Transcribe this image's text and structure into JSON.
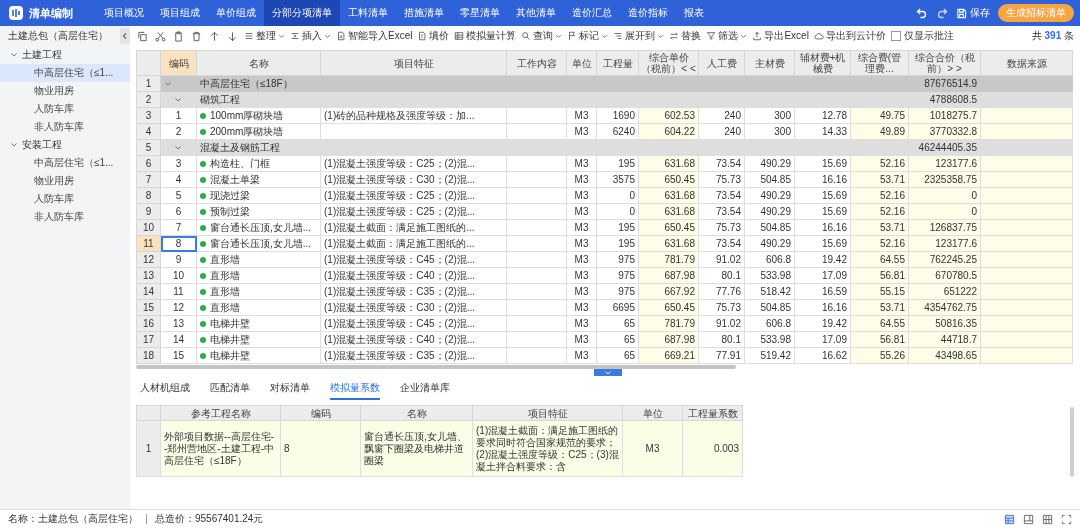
{
  "app": {
    "title": "清单编制"
  },
  "nav": [
    {
      "label": "项目概况",
      "selected": false
    },
    {
      "label": "项目组成",
      "selected": false
    },
    {
      "label": "单价组成",
      "selected": false
    },
    {
      "label": "分部分项清单",
      "selected": true
    },
    {
      "label": "工料清单",
      "selected": false
    },
    {
      "label": "措施清单",
      "selected": false
    },
    {
      "label": "零星清单",
      "selected": false
    },
    {
      "label": "其他清单",
      "selected": false
    },
    {
      "label": "造价汇总",
      "selected": false
    },
    {
      "label": "造价指标",
      "selected": false
    },
    {
      "label": "报表",
      "selected": false
    }
  ],
  "header_actions": {
    "save": "保存",
    "generate": "生成招标清单"
  },
  "project": {
    "name": "土建总包（高层住宅）"
  },
  "toolbar": [
    {
      "label": "整理",
      "dropdown": true
    },
    {
      "label": "插入",
      "dropdown": true
    },
    {
      "label": "智能导入Excel",
      "dropdown": false
    },
    {
      "label": "填价",
      "dropdown": false
    },
    {
      "label": "模拟量计算",
      "dropdown": false
    },
    {
      "label": "查询",
      "dropdown": true
    },
    {
      "label": "标记",
      "dropdown": true
    },
    {
      "label": "展开到",
      "dropdown": true
    },
    {
      "label": "替换",
      "dropdown": false
    },
    {
      "label": "筛选",
      "dropdown": true
    },
    {
      "label": "导出Excel",
      "dropdown": false
    },
    {
      "label": "导出到云计价",
      "dropdown": false
    }
  ],
  "filter_checkbox": {
    "label": "仅显示批注",
    "checked": false
  },
  "count": {
    "prefix": "共",
    "value": "391",
    "suffix": "条"
  },
  "sidebar": {
    "tree": [
      {
        "label": "土建工程",
        "expanded": true,
        "children": [
          {
            "label": "中高层住宅（≤1...",
            "selected": true
          },
          {
            "label": "物业用房",
            "selected": false
          },
          {
            "label": "人防车库",
            "selected": false
          },
          {
            "label": "非人防车库",
            "selected": false
          }
        ]
      },
      {
        "label": "安装工程",
        "expanded": true,
        "children": [
          {
            "label": "中高层住宅（≤1...",
            "selected": false
          },
          {
            "label": "物业用房",
            "selected": false
          },
          {
            "label": "人防车库",
            "selected": false
          },
          {
            "label": "非人防车库",
            "selected": false
          }
        ]
      }
    ]
  },
  "table": {
    "columns": [
      {
        "label": "编码",
        "selected": true,
        "highlight": false
      },
      {
        "label": "名称",
        "selected": false,
        "highlight": false
      },
      {
        "label": "项目特征",
        "selected": false,
        "highlight": false
      },
      {
        "label": "工作内容",
        "selected": false,
        "highlight": false
      },
      {
        "label": "单位",
        "selected": false,
        "highlight": false
      },
      {
        "label": "工程量",
        "selected": false,
        "highlight": false
      },
      {
        "label": "综合单价（税前）< <",
        "selected": false,
        "highlight": true
      },
      {
        "label": "人工费",
        "selected": false,
        "highlight": false
      },
      {
        "label": "主材费",
        "selected": false,
        "highlight": false
      },
      {
        "label": "辅材费+机械费",
        "selected": false,
        "highlight": false
      },
      {
        "label": "综合费(管理费...",
        "selected": false,
        "highlight": true
      },
      {
        "label": "综合合价（税前）> >",
        "selected": false,
        "highlight": true
      },
      {
        "label": "数据来源",
        "selected": false,
        "highlight": true
      }
    ],
    "rows": [
      {
        "kind": "group",
        "row": "1",
        "name": "中高层住宅（≤18F）",
        "total": "87676514.9",
        "expanded": true,
        "selected": false,
        "children": [
          {
            "kind": "group",
            "row": "2",
            "name": "砌筑工程",
            "total": "4788608.5",
            "expanded": true,
            "selected": false,
            "children": [
              {
                "kind": "item",
                "row": "3",
                "selected": false,
                "code": "1",
                "name": "100mm厚砌块墙",
                "feature": "(1)砖的品种规格及强度等级：加...",
                "unit": "M3",
                "quantity": "1690",
                "unit_price": "602.53",
                "labor": "240",
                "material": "300",
                "aux_machine": "12.78",
                "overhead": "49.75",
                "total": "1018275.7"
              },
              {
                "kind": "item",
                "row": "4",
                "selected": false,
                "code": "2",
                "name": "200mm厚砌块墙",
                "unit": "M3",
                "quantity": "6240",
                "unit_price": "604.22",
                "labor": "240",
                "material": "300",
                "aux_machine": "14.33",
                "overhead": "49.89",
                "total": "3770332.8"
              }
            ]
          },
          {
            "kind": "group",
            "row": "5",
            "name": "混凝土及钢筋工程",
            "total": "46244405.35",
            "expanded": true,
            "selected": false,
            "children": [
              {
                "kind": "item",
                "row": "6",
                "selected": false,
                "code": "3",
                "name": "构造柱、门框",
                "feature": "(1)混凝土强度等级：C25；(2)混...",
                "unit": "M3",
                "quantity": "195",
                "unit_price": "631.68",
                "labor": "73.54",
                "material": "490.29",
                "aux_machine": "15.69",
                "overhead": "52.16",
                "total": "123177.6"
              },
              {
                "kind": "item",
                "row": "7",
                "selected": false,
                "code": "4",
                "name": "混凝土单梁",
                "feature": "(1)混凝土强度等级：C30；(2)混...",
                "unit": "M3",
                "quantity": "3575",
                "unit_price": "650.45",
                "labor": "75.73",
                "material": "504.85",
                "aux_machine": "16.16",
                "overhead": "53.71",
                "total": "2325358.75"
              },
              {
                "kind": "item",
                "row": "8",
                "selected": false,
                "code": "5",
                "name": "现浇过梁",
                "feature": "(1)混凝土强度等级：C25；(2)混...",
                "unit": "M3",
                "quantity": "0",
                "unit_price": "631.68",
                "labor": "73.54",
                "material": "490.29",
                "aux_machine": "15.69",
                "overhead": "52.16",
                "total": "0"
              },
              {
                "kind": "item",
                "row": "9",
                "selected": false,
                "code": "6",
                "name": "预制过梁",
                "feature": "(1)混凝土强度等级：C25；(2)混...",
                "unit": "M3",
                "quantity": "0",
                "unit_price": "631.68",
                "labor": "73.54",
                "material": "490.29",
                "aux_machine": "15.69",
                "overhead": "52.16",
                "total": "0"
              },
              {
                "kind": "item",
                "row": "10",
                "selected": false,
                "code": "7",
                "name": "窗台通长压顶,女儿墙...",
                "feature": "(1)混凝土截面：满足施工图纸的...",
                "unit": "M3",
                "quantity": "195",
                "unit_price": "650.45",
                "labor": "75.73",
                "material": "504.85",
                "aux_machine": "16.16",
                "overhead": "53.71",
                "total": "126837.75"
              },
              {
                "kind": "item",
                "row": "11",
                "selected": true,
                "code": "8",
                "name": "窗台通长压顶,女儿墙...",
                "feature": "(1)混凝土截面：满足施工图纸的...",
                "unit": "M3",
                "quantity": "195",
                "unit_price": "631.68",
                "labor": "73.54",
                "material": "490.29",
                "aux_machine": "15.69",
                "overhead": "52.16",
                "total": "123177.6"
              },
              {
                "kind": "item",
                "row": "12",
                "selected": false,
                "code": "9",
                "name": "直形墙",
                "feature": "(1)混凝土强度等级：C45；(2)混...",
                "unit": "M3",
                "quantity": "975",
                "unit_price": "781.79",
                "labor": "91.02",
                "material": "606.8",
                "aux_machine": "19.42",
                "overhead": "64.55",
                "total": "762245.25"
              },
              {
                "kind": "item",
                "row": "13",
                "selected": false,
                "code": "10",
                "name": "直形墙",
                "feature": "(1)混凝土强度等级：C40；(2)混...",
                "unit": "M3",
                "quantity": "975",
                "unit_price": "687.98",
                "labor": "80.1",
                "material": "533.98",
                "aux_machine": "17.09",
                "overhead": "56.81",
                "total": "670780.5"
              },
              {
                "kind": "item",
                "row": "14",
                "selected": false,
                "code": "11",
                "name": "直形墙",
                "feature": "(1)混凝土强度等级：C35；(2)混...",
                "unit": "M3",
                "quantity": "975",
                "unit_price": "667.92",
                "labor": "77.76",
                "material": "518.42",
                "aux_machine": "16.59",
                "overhead": "55.15",
                "total": "651222"
              },
              {
                "kind": "item",
                "row": "15",
                "selected": false,
                "code": "12",
                "name": "直形墙",
                "feature": "(1)混凝土强度等级：C30；(2)混...",
                "unit": "M3",
                "quantity": "6695",
                "unit_price": "650.45",
                "labor": "75.73",
                "material": "504.85",
                "aux_machine": "16.16",
                "overhead": "53.71",
                "total": "4354762.75"
              },
              {
                "kind": "item",
                "row": "16",
                "selected": false,
                "code": "13",
                "name": "电梯井壁",
                "feature": "(1)混凝土强度等级：C45；(2)混...",
                "unit": "M3",
                "quantity": "65",
                "unit_price": "781.79",
                "labor": "91.02",
                "material": "606.8",
                "aux_machine": "19.42",
                "overhead": "64.55",
                "total": "50816.35"
              },
              {
                "kind": "item",
                "row": "17",
                "selected": false,
                "code": "14",
                "name": "电梯井壁",
                "feature": "(1)混凝土强度等级：C40；(2)混...",
                "unit": "M3",
                "quantity": "65",
                "unit_price": "687.98",
                "labor": "80.1",
                "material": "533.98",
                "aux_machine": "17.09",
                "overhead": "56.81",
                "total": "44718.7"
              },
              {
                "kind": "item",
                "row": "18",
                "selected": false,
                "code": "15",
                "name": "电梯井壁",
                "feature": "(1)混凝土强度等级：C35；(2)混...",
                "unit": "M3",
                "quantity": "65",
                "unit_price": "669.21",
                "labor": "77.91",
                "material": "519.42",
                "aux_machine": "16.62",
                "overhead": "55.26",
                "total": "43498.65"
              }
            ]
          }
        ]
      }
    ]
  },
  "bottom": {
    "tabs": [
      {
        "label": "人材机组成",
        "selected": false
      },
      {
        "label": "匹配清单",
        "selected": false
      },
      {
        "label": "对标清单",
        "selected": false
      },
      {
        "label": "模拟量系数",
        "selected": true
      },
      {
        "label": "企业清单库",
        "selected": false
      }
    ],
    "columns": [
      "参考工程名称",
      "编码",
      "名称",
      "项目特征",
      "单位",
      "工程量系数"
    ],
    "rows": [
      {
        "row": "1",
        "ref_project": "外部项目数据--高层住宅--郑州营地区-土建工程-中高层住宅（≤18F）",
        "code": "8",
        "name": "窗台通长压顶,女儿墙、飘窗下圈梁及电梯井道圈梁",
        "feature": "(1)混凝土截面：满足施工图纸的要求同时符合国家规范的要求；(2)混凝土强度等级：C25；(3)混凝土拌合料要求：含",
        "unit": "M3",
        "coefficient": "0.003"
      }
    ]
  },
  "view_modes": [
    {
      "selected": true
    },
    {
      "selected": false
    },
    {
      "selected": false
    },
    {
      "selected": false
    }
  ],
  "status_bar": {
    "name": "名称：土建总包（高层住宅）",
    "total": "总造价：95567401.24元"
  }
}
